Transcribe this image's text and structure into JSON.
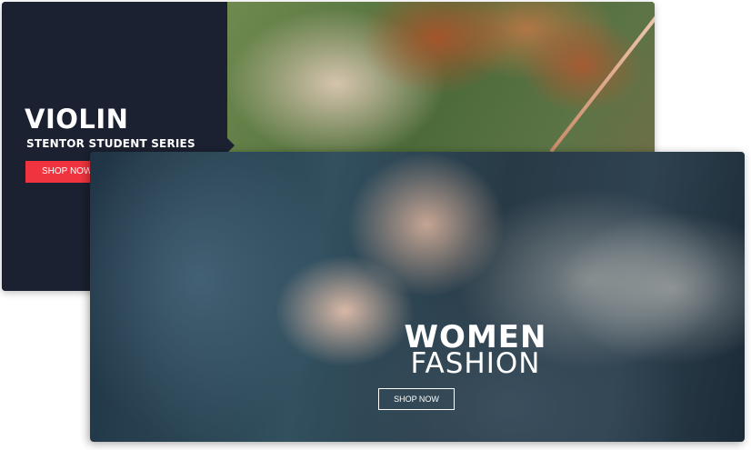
{
  "violin_banner": {
    "title": "VIOLIN",
    "subtitle": "STENTOR STUDENT SERIES",
    "button_label": "SHOP NOW",
    "colors": {
      "panel": "#1b2130",
      "button": "#f0343f"
    }
  },
  "fashion_banner": {
    "title": "WOMEN",
    "subtitle": "FASHION",
    "button_label": "SHOP NOW"
  }
}
